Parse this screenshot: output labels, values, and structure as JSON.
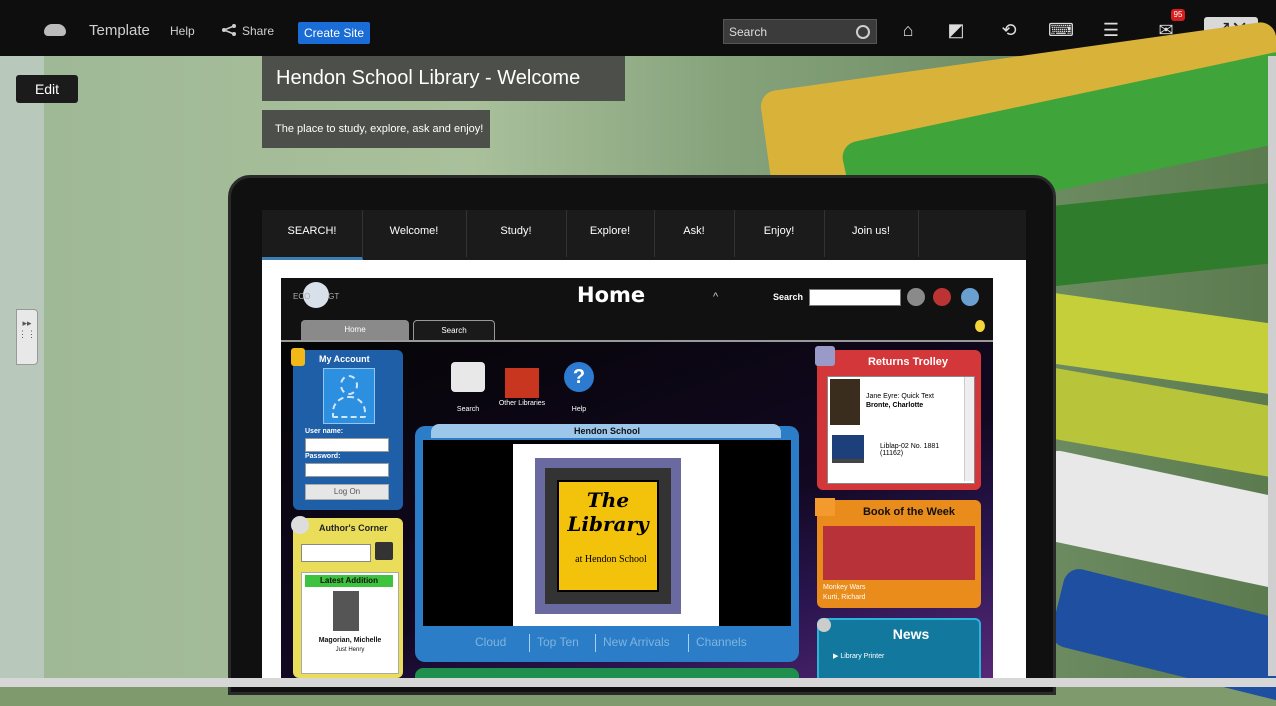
{
  "topbar": {
    "template": "Template",
    "help": "Help",
    "share": "Share",
    "create_site": "Create Site",
    "search_placeholder": "Search",
    "notifications": "95"
  },
  "edit_button": "Edit",
  "site": {
    "title": "Hendon School Library - Welcome",
    "subtitle": "The place to study, explore, ask and enjoy!",
    "nav": [
      "SEARCH!",
      "Welcome!",
      "Study!",
      "Explore!",
      "Ask!",
      "Enjoy!",
      "Join us!"
    ]
  },
  "library": {
    "page_title": "Home",
    "search_label": "Search",
    "tabs": [
      "Home",
      "Search"
    ],
    "my_account": {
      "title": "My Account",
      "username_label": "User name:",
      "password_label": "Password:",
      "logon": "Log On"
    },
    "authors_corner": {
      "title": "Author's Corner",
      "latest_addition": "Latest Addition",
      "author": "Magorian, Michelle",
      "book": "Just Henry"
    },
    "center_icons": [
      "Search",
      "Other Libraries",
      "Help"
    ],
    "panel": {
      "title": "Hendon School",
      "img_the": "The",
      "img_library": "Library",
      "img_at": "at Hendon School",
      "links": [
        "Cloud",
        "Top Ten",
        "New Arrivals",
        "Channels"
      ]
    },
    "returns": {
      "title": "Returns Trolley",
      "item1_title": "Jane Eyre: Quick Text",
      "item1_author": "Bronte, Charlotte",
      "item2": "Liblap-02 No. 1881 (11162)"
    },
    "book_of_week": {
      "title": "Book of the Week",
      "book": "Monkey Wars",
      "author": "Kurti, Richard"
    },
    "news": {
      "title": "News",
      "item": "Library Printer"
    }
  },
  "colors": {
    "accent": "#1a6cd6",
    "badge": "#d81d1d"
  }
}
